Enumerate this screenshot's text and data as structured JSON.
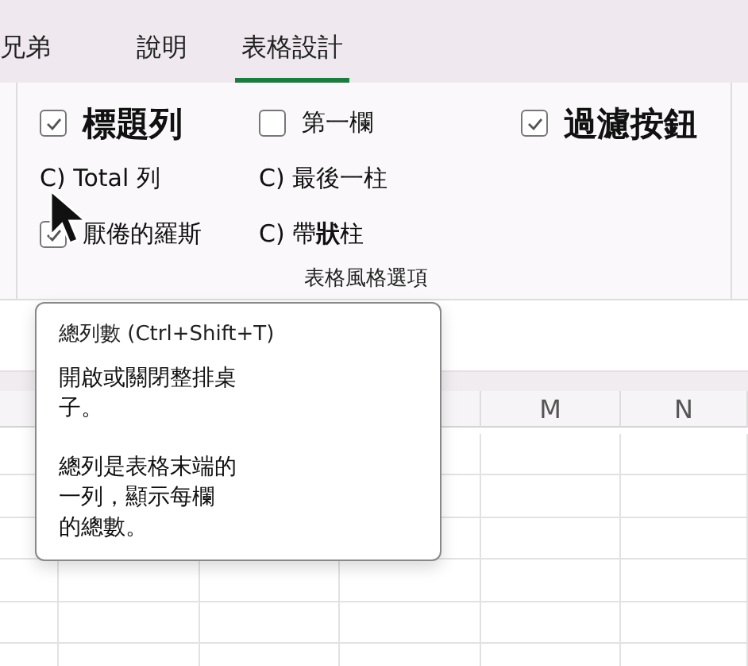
{
  "tabs": [
    {
      "label": "兄弟",
      "selected": false
    },
    {
      "label": "說明",
      "selected": false
    },
    {
      "label": "表格設計",
      "selected": true
    }
  ],
  "ribbon": {
    "columns": [
      {
        "options": [
          {
            "kind": "checkbox",
            "label": "標題列",
            "checked": true,
            "emphasis": true
          },
          {
            "kind": "text",
            "label": "C) Total 列"
          },
          {
            "kind": "checkbox",
            "label": "厭倦的羅斯",
            "checked": true,
            "emphasis": false
          }
        ]
      },
      {
        "options": [
          {
            "kind": "checkbox",
            "label": "第一欄",
            "checked": false,
            "emphasis": false
          },
          {
            "kind": "text",
            "label": "C) 最後一柱"
          },
          {
            "kind": "text",
            "label": "C) 帶**狀**柱"
          }
        ]
      },
      {
        "options": [
          {
            "kind": "checkbox",
            "label": "過濾按鈕",
            "checked": true,
            "emphasis": true
          }
        ]
      }
    ],
    "group_label": "表格風格選項"
  },
  "sheet": {
    "column_headers": [
      "M",
      "N"
    ]
  },
  "tooltip": {
    "title": "總列數 (Ctrl+Shift+T)",
    "paragraphs": [
      [
        "開啟或關閉整排桌",
        "子。"
      ],
      [
        "總列是表格末端的",
        "一列，顯示每欄",
        "的總數。"
      ]
    ]
  }
}
